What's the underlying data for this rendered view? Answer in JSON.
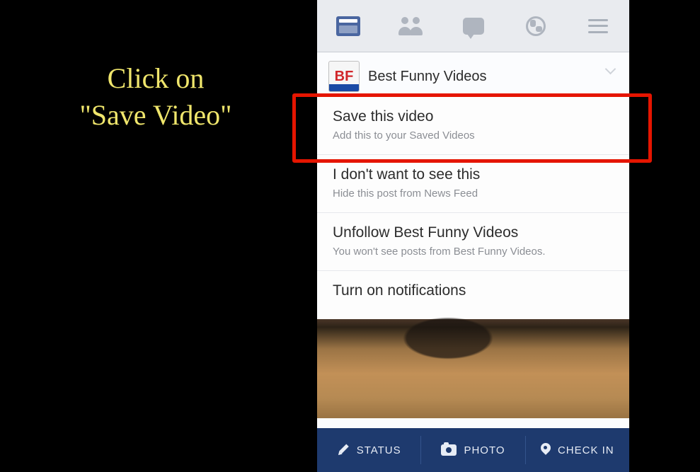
{
  "instruction": {
    "line1": "Click on",
    "line2": "\"Save Video\""
  },
  "post": {
    "page_name": "Best Funny Videos",
    "avatar_text": "BF"
  },
  "menu": {
    "items": [
      {
        "title": "Save this video",
        "sub": "Add this to your Saved Videos"
      },
      {
        "title": "I don't want to see this",
        "sub": "Hide this post from News Feed"
      },
      {
        "title": "Unfollow Best Funny Videos",
        "sub": "You won't see posts from Best Funny Videos."
      },
      {
        "title": "Turn on notifications",
        "sub": ""
      }
    ]
  },
  "bottom": {
    "status": "STATUS",
    "photo": "PHOTO",
    "checkin": "CHECK IN"
  }
}
